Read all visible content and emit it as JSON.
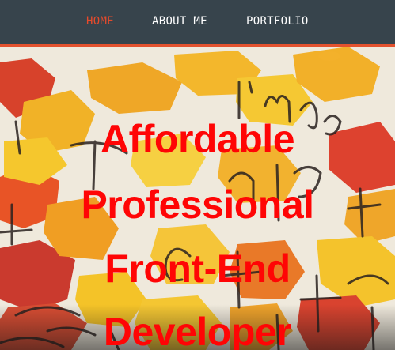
{
  "nav": {
    "items": [
      {
        "label": "HOME",
        "active": true
      },
      {
        "label": "ABOUT ME",
        "active": false
      },
      {
        "label": "PORTFOLIO",
        "active": false
      }
    ],
    "accent_color": "#e64a2b",
    "background_color": "#37444c"
  },
  "hero": {
    "headline_lines": [
      "Affordable",
      "Professional",
      "Front-End",
      "Developer"
    ],
    "headline_color": "#ff0505",
    "background_handwriting": [
      "I'm",
      "happy",
      "I",
      "only",
      "that",
      "that",
      "Ha"
    ]
  }
}
